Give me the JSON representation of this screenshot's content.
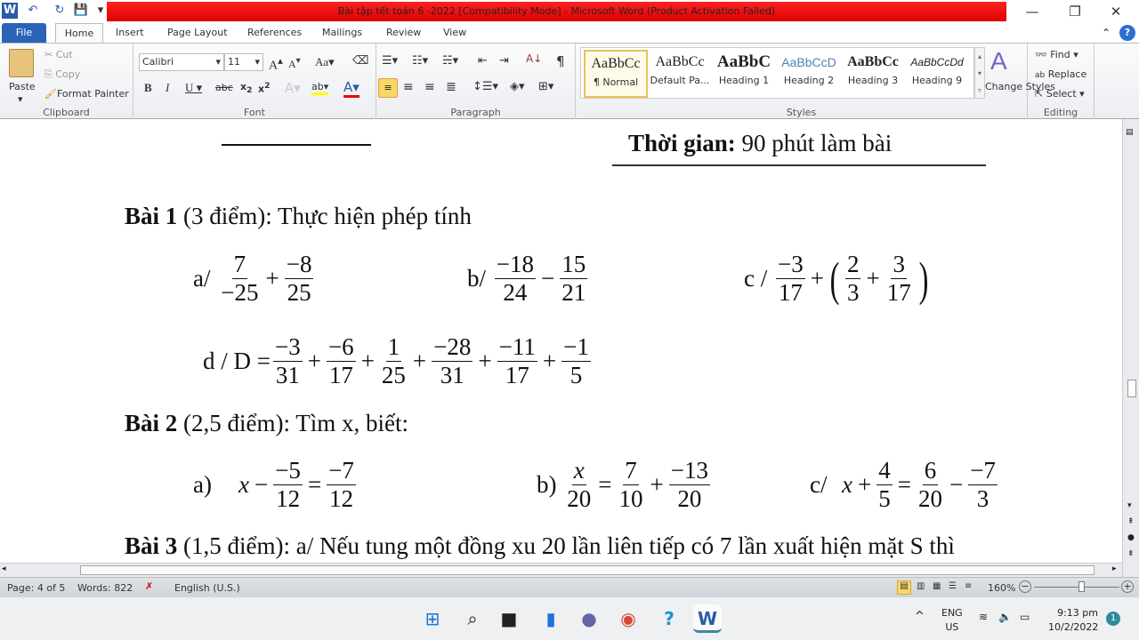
{
  "window": {
    "title": "Bài tập tết toán 6 -2022 [Compatibility Mode]  -  Microsoft Word (Product Activation Failed)",
    "minimize": "—",
    "restore": "❐",
    "close": "✕"
  },
  "tabs": [
    "File",
    "Home",
    "Insert",
    "Page Layout",
    "References",
    "Mailings",
    "Review",
    "View"
  ],
  "clipboard": {
    "paste": "Paste",
    "cut": "Cut",
    "copy": "Copy",
    "format_painter": "Format Painter",
    "label": "Clipboard"
  },
  "font": {
    "name": "Calibri",
    "size": "11",
    "label": "Font"
  },
  "paragraph": {
    "label": "Paragraph"
  },
  "styles": {
    "label": "Styles",
    "items": [
      {
        "sample": "AaBbCc",
        "name": "¶ Normal"
      },
      {
        "sample": "AaBbCc",
        "name": "Default Pa..."
      },
      {
        "sample": "AaBbC",
        "name": "Heading 1"
      },
      {
        "sample": "AaBbCcD",
        "name": "Heading 2"
      },
      {
        "sample": "AaBbCc",
        "name": "Heading 3"
      },
      {
        "sample": "AaBbCcDd",
        "name": "Heading 9"
      }
    ],
    "change_styles": "Change Styles"
  },
  "editing": {
    "label": "Editing",
    "find": "Find",
    "replace": "Replace",
    "select": "Select"
  },
  "document": {
    "time_label": "Thời gian:",
    "time_value": "90 phút làm bài",
    "bai1": {
      "title": "Bài 1",
      "points": "(3 điểm): Thực hiện phép tính"
    },
    "bai2": {
      "title": "Bài 2",
      "points": "(2,5 điểm): Tìm x, biết:"
    },
    "bai3": {
      "title": "Bài 3",
      "points": "(1,5 điểm): a/ Nếu tung một đồng xu 20 lần liên tiếp có 7 lần xuất hiện mặt S thì"
    },
    "expressions": [
      {
        "tokens": [
          {
            "t": "text",
            "v": "a/ "
          },
          {
            "t": "frac",
            "n": "7",
            "d": "−25"
          },
          {
            "t": "op",
            "v": "+"
          },
          {
            "t": "frac",
            "n": "−8",
            "d": "25"
          }
        ]
      },
      {
        "tokens": [
          {
            "t": "text",
            "v": "b/ "
          },
          {
            "t": "frac",
            "n": "−18",
            "d": "24"
          },
          {
            "t": "op",
            "v": "−"
          },
          {
            "t": "frac",
            "n": "15",
            "d": "21"
          }
        ]
      },
      {
        "tokens": [
          {
            "t": "text",
            "v": "c / "
          },
          {
            "t": "frac",
            "n": "−3",
            "d": "17"
          },
          {
            "t": "op",
            "v": "+"
          },
          {
            "t": "paren",
            "v": "("
          },
          {
            "t": "frac",
            "n": "2",
            "d": "3"
          },
          {
            "t": "op",
            "v": "+"
          },
          {
            "t": "frac",
            "n": "3",
            "d": "17"
          },
          {
            "t": "paren",
            "v": ")"
          }
        ]
      },
      {
        "tokens": [
          {
            "t": "text",
            "v": "d / D ="
          },
          {
            "t": "frac",
            "n": "−3",
            "d": "31"
          },
          {
            "t": "op",
            "v": "+"
          },
          {
            "t": "frac",
            "n": "−6",
            "d": "17"
          },
          {
            "t": "op",
            "v": "+"
          },
          {
            "t": "frac",
            "n": "1",
            "d": "25"
          },
          {
            "t": "op",
            "v": "+"
          },
          {
            "t": "frac",
            "n": "−28",
            "d": "31"
          },
          {
            "t": "op",
            "v": "+"
          },
          {
            "t": "frac",
            "n": "−11",
            "d": "17"
          },
          {
            "t": "op",
            "v": "+"
          },
          {
            "t": "frac",
            "n": "−1",
            "d": "5"
          }
        ]
      },
      {
        "tokens": [
          {
            "t": "text",
            "v": "a)    "
          },
          {
            "t": "var",
            "v": "x"
          },
          {
            "t": "op",
            "v": "−"
          },
          {
            "t": "frac",
            "n": "−5",
            "d": "12"
          },
          {
            "t": "op",
            "v": "="
          },
          {
            "t": "frac",
            "n": "−7",
            "d": "12"
          }
        ]
      },
      {
        "tokens": [
          {
            "t": "text",
            "v": "b) "
          },
          {
            "t": "frac",
            "n": "x",
            "d": "20",
            "ni": true
          },
          {
            "t": "op",
            "v": "="
          },
          {
            "t": "frac",
            "n": "7",
            "d": "10"
          },
          {
            "t": "op",
            "v": "+"
          },
          {
            "t": "frac",
            "n": "−13",
            "d": "20"
          }
        ]
      },
      {
        "tokens": [
          {
            "t": "text",
            "v": "c/  "
          },
          {
            "t": "var",
            "v": "x"
          },
          {
            "t": "op",
            "v": "+"
          },
          {
            "t": "frac",
            "n": "4",
            "d": "5"
          },
          {
            "t": "op",
            "v": "="
          },
          {
            "t": "frac",
            "n": "6",
            "d": "20"
          },
          {
            "t": "op",
            "v": "−"
          },
          {
            "t": "frac",
            "n": "−7",
            "d": "3"
          }
        ]
      }
    ]
  },
  "status": {
    "page": "Page: 4 of 5",
    "words": "Words: 822",
    "language": "English (U.S.)",
    "zoom": "160%"
  },
  "taskbar": {
    "lang1": "ENG",
    "lang2": "US",
    "time": "9:13 pm",
    "date": "10/2/2022",
    "notifications": "1"
  }
}
